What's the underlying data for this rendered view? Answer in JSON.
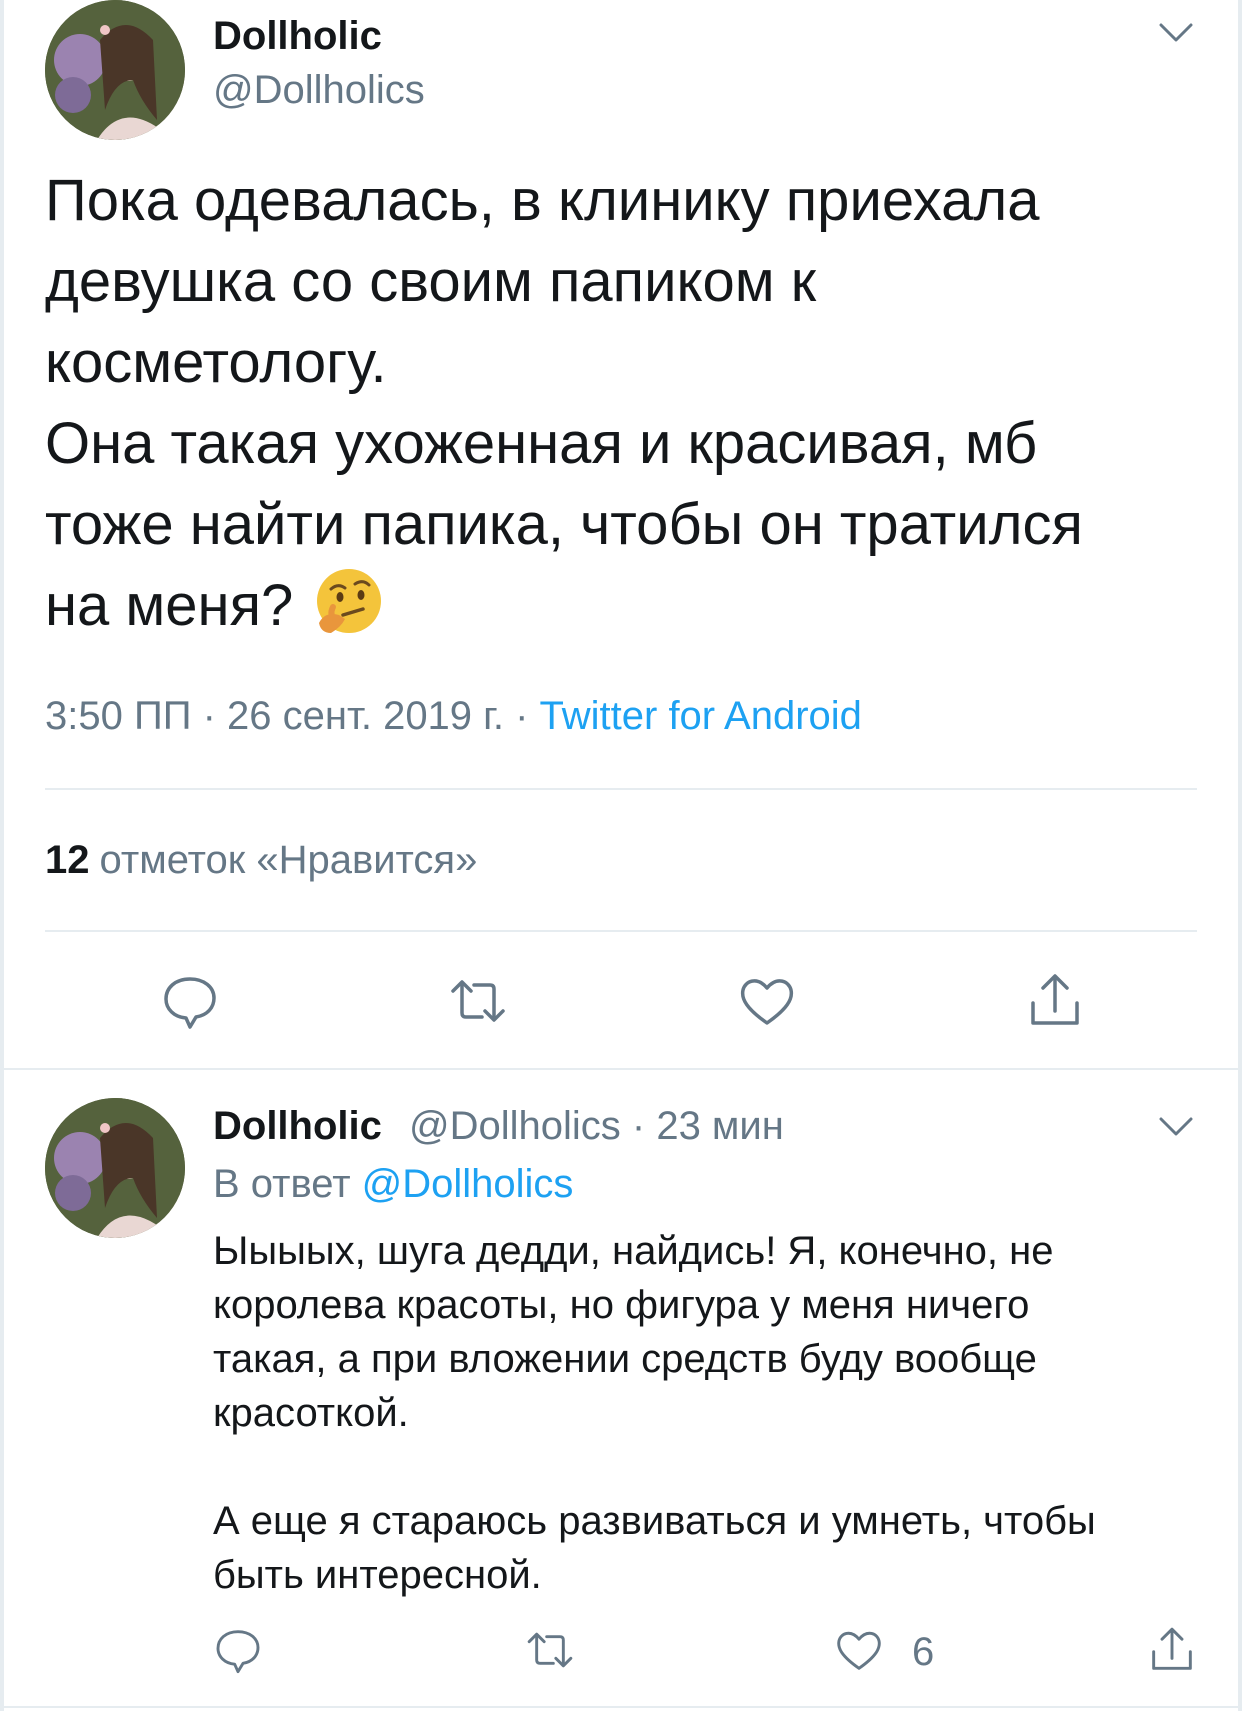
{
  "tweet": {
    "author_name": "Dollholic",
    "author_handle": "@Dollholics",
    "text_lines": [
      "Пока одевалась, в клинику приехала",
      "девушка со своим папиком к",
      "косметологу.",
      "Она такая ухоженная и красивая, мб",
      "тоже найти папика, чтобы он тратился",
      "на меня?"
    ],
    "emoji": "thinking-face",
    "time": "3:50 ПП · 26 сент. 2019 г. · ",
    "source": "Twitter for Android",
    "likes_count": "12",
    "likes_label": "отметок «Нравится»"
  },
  "reply": {
    "author_name": "Dollholic",
    "author_handle": "@Dollholics · 23 мин",
    "reply_to_label": "В ответ ",
    "reply_to_handle": "@Dollholics",
    "text_lines_1": [
      "Ыыыых, шуга дедди, найдись! Я, конечно, не",
      "королева красоты, но фигура у меня ничего",
      "такая, а при вложении средств буду вообще",
      "красоткой."
    ],
    "text_lines_2": [
      "А еще я стараюсь развиваться и умнеть, чтобы",
      "быть интересной."
    ],
    "like_count": "6"
  },
  "icons": [
    "chevron-down-icon",
    "reply-icon",
    "retweet-icon",
    "like-icon",
    "share-icon"
  ],
  "colors": {
    "text": "#14171a",
    "secondary": "#657786",
    "link": "#1da1f2",
    "divider": "#e6ecf0"
  }
}
